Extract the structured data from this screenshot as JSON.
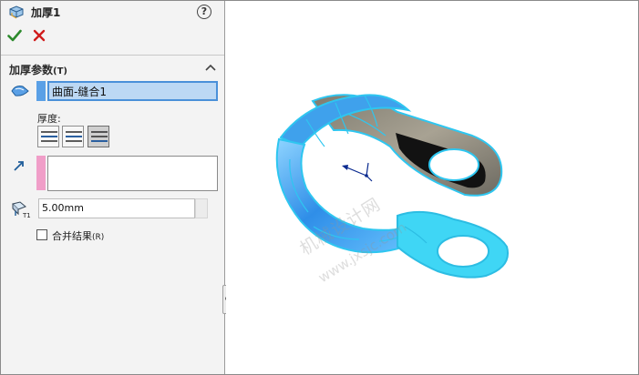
{
  "header": {
    "title": "加厚1",
    "help_label": "?"
  },
  "actions": {
    "ok": "confirm",
    "cancel": "cancel"
  },
  "group": {
    "label": "加厚参数",
    "shortcut": "(T)"
  },
  "selection": {
    "value": "曲面-缝合1"
  },
  "thickness": {
    "label": "厚度:",
    "options": [
      "side-1",
      "both-sides",
      "side-2"
    ],
    "selected": "side-2"
  },
  "thickness_value": {
    "value": "5.00mm"
  },
  "merge": {
    "label": "合并结果",
    "shortcut": "(R)",
    "checked": false
  },
  "watermark": {
    "line1": "机械设计网",
    "line2": "www.jxsjc.com"
  },
  "colors": {
    "selection_bar": "#5aa0e6",
    "direction_bar": "#f09ec8",
    "part_highlight": "#3fd6f5",
    "part_shaded": "#8a8478",
    "ok": "#2c8a2c",
    "cancel": "#d01c1c"
  },
  "icons": {
    "feature": "thicken-feature-icon",
    "help": "help-icon",
    "ok": "checkmark-icon",
    "cancel": "x-icon",
    "collapse": "chevron-up-icon",
    "selection": "surface-select-icon",
    "direction": "direction-arrow-icon",
    "thickness": "thickness-t1-icon"
  }
}
